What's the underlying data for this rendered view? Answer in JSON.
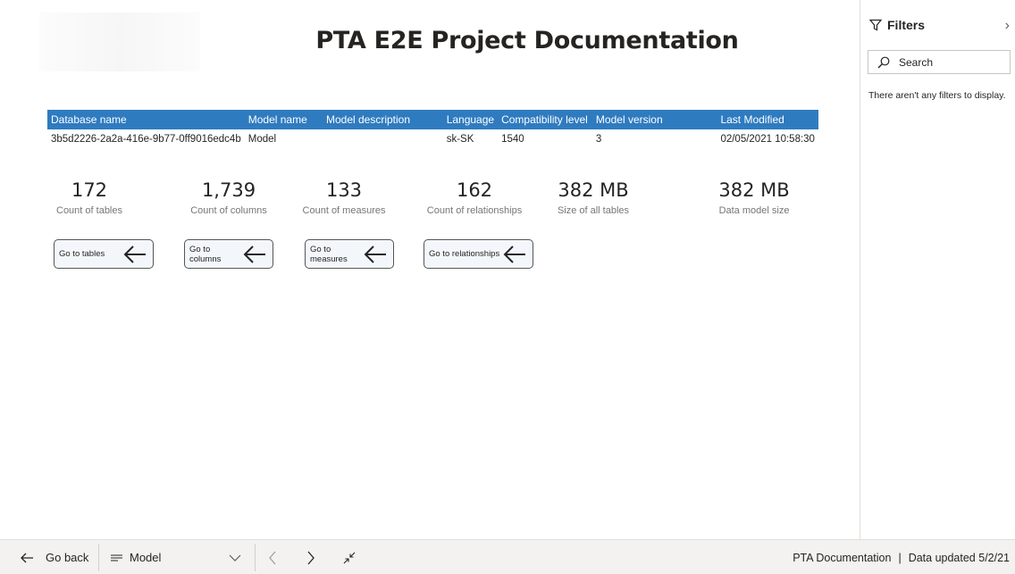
{
  "report": {
    "title": "PTA E2E Project Documentation"
  },
  "table": {
    "columns": [
      "Database name",
      "Model name",
      "Model description",
      "Language",
      "Compatibility level",
      "Model version",
      "Last Modified"
    ],
    "rows": [
      [
        "3b5d2226-2a2a-416e-9b77-0ff9016edc4b",
        "Model",
        "",
        "sk-SK",
        "1540",
        "3",
        "02/05/2021 10:58:30"
      ]
    ]
  },
  "kpis": [
    {
      "value": "172",
      "label": "Count of tables"
    },
    {
      "value": "1,739",
      "label": "Count of columns"
    },
    {
      "value": "133",
      "label": "Count of measures"
    },
    {
      "value": "162",
      "label": "Count of relationships"
    },
    {
      "value": "382 MB",
      "label": "Size of all tables"
    },
    {
      "value": "382 MB",
      "label": "Data model size"
    }
  ],
  "nav_buttons": [
    {
      "label": "Go to tables",
      "icon": "arrow-left-icon"
    },
    {
      "label": "Go to columns",
      "icon": "arrow-left-icon"
    },
    {
      "label": "Go to measures",
      "icon": "arrow-left-icon"
    },
    {
      "label": "Go to relationships",
      "icon": "arrow-left-icon"
    }
  ],
  "filters": {
    "title": "Filters",
    "search_placeholder": "Search",
    "empty_message": "There aren't any filters to display."
  },
  "bottom_bar": {
    "go_back": "Go back",
    "page_name": "Model",
    "report_name": "PTA Documentation",
    "separator": "|",
    "updated": "Data updated 5/2/21"
  },
  "colors": {
    "table_header": "#2f7bc0",
    "button_border": "#555555",
    "label_gray": "#767676"
  }
}
